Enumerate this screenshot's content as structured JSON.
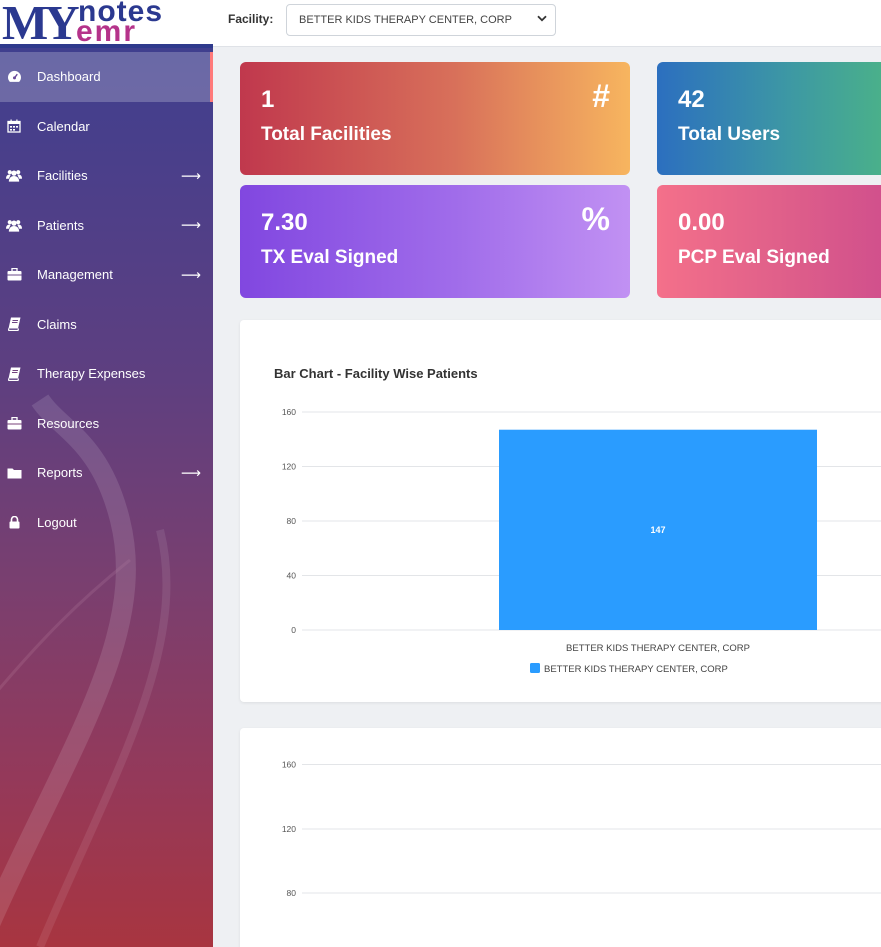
{
  "brand": {
    "my": "MY",
    "notes": "notes",
    "emr": "emr"
  },
  "sidebar": {
    "items": [
      {
        "label": "Dashboard",
        "icon": "dashboard-icon",
        "arrow": false,
        "active": true
      },
      {
        "label": "Calendar",
        "icon": "calendar-icon",
        "arrow": false
      },
      {
        "label": "Facilities",
        "icon": "users-icon",
        "arrow": true
      },
      {
        "label": "Patients",
        "icon": "users-icon",
        "arrow": true
      },
      {
        "label": "Management",
        "icon": "briefcase-icon",
        "arrow": true
      },
      {
        "label": "Claims",
        "icon": "book-icon",
        "arrow": false
      },
      {
        "label": "Therapy Expenses",
        "icon": "book-icon",
        "arrow": false
      },
      {
        "label": "Resources",
        "icon": "briefcase-icon",
        "arrow": false
      },
      {
        "label": "Reports",
        "icon": "folder-icon",
        "arrow": true
      },
      {
        "label": "Logout",
        "icon": "lock-icon",
        "arrow": false
      }
    ],
    "arrow_glyph": "⟶"
  },
  "topbar": {
    "facility_label": "Facility:",
    "facility_selected": "BETTER KIDS THERAPY CENTER, CORP"
  },
  "cards": [
    {
      "value": "1",
      "label": "Total Facilities",
      "symbol": "#"
    },
    {
      "value": "42",
      "label": "Total Users",
      "symbol": ""
    },
    {
      "value": "7.30",
      "label": "TX Eval Signed",
      "symbol": "%"
    },
    {
      "value": "0.00",
      "label": "PCP Eval Signed",
      "symbol": ""
    }
  ],
  "chart_data": [
    {
      "type": "bar",
      "title": "Bar Chart - Facility Wise Patients",
      "categories": [
        "BETTER KIDS THERAPY CENTER, CORP"
      ],
      "series": [
        {
          "name": "BETTER KIDS THERAPY CENTER, CORP",
          "values": [
            147
          ]
        }
      ],
      "ylim": [
        0,
        160
      ],
      "yticks": [
        "160",
        "120",
        "80",
        "40",
        "0"
      ],
      "grid": true,
      "legend": "bottom",
      "bar_color": "#2a9cff"
    },
    {
      "type": "bar",
      "title": "",
      "ylim": [
        0,
        160
      ],
      "yticks": [
        "160",
        "120",
        "80"
      ],
      "grid": true
    }
  ],
  "colors": {
    "accent": "#2a9cff",
    "brand_blue": "#2b3990",
    "brand_pink": "#b5338a"
  }
}
